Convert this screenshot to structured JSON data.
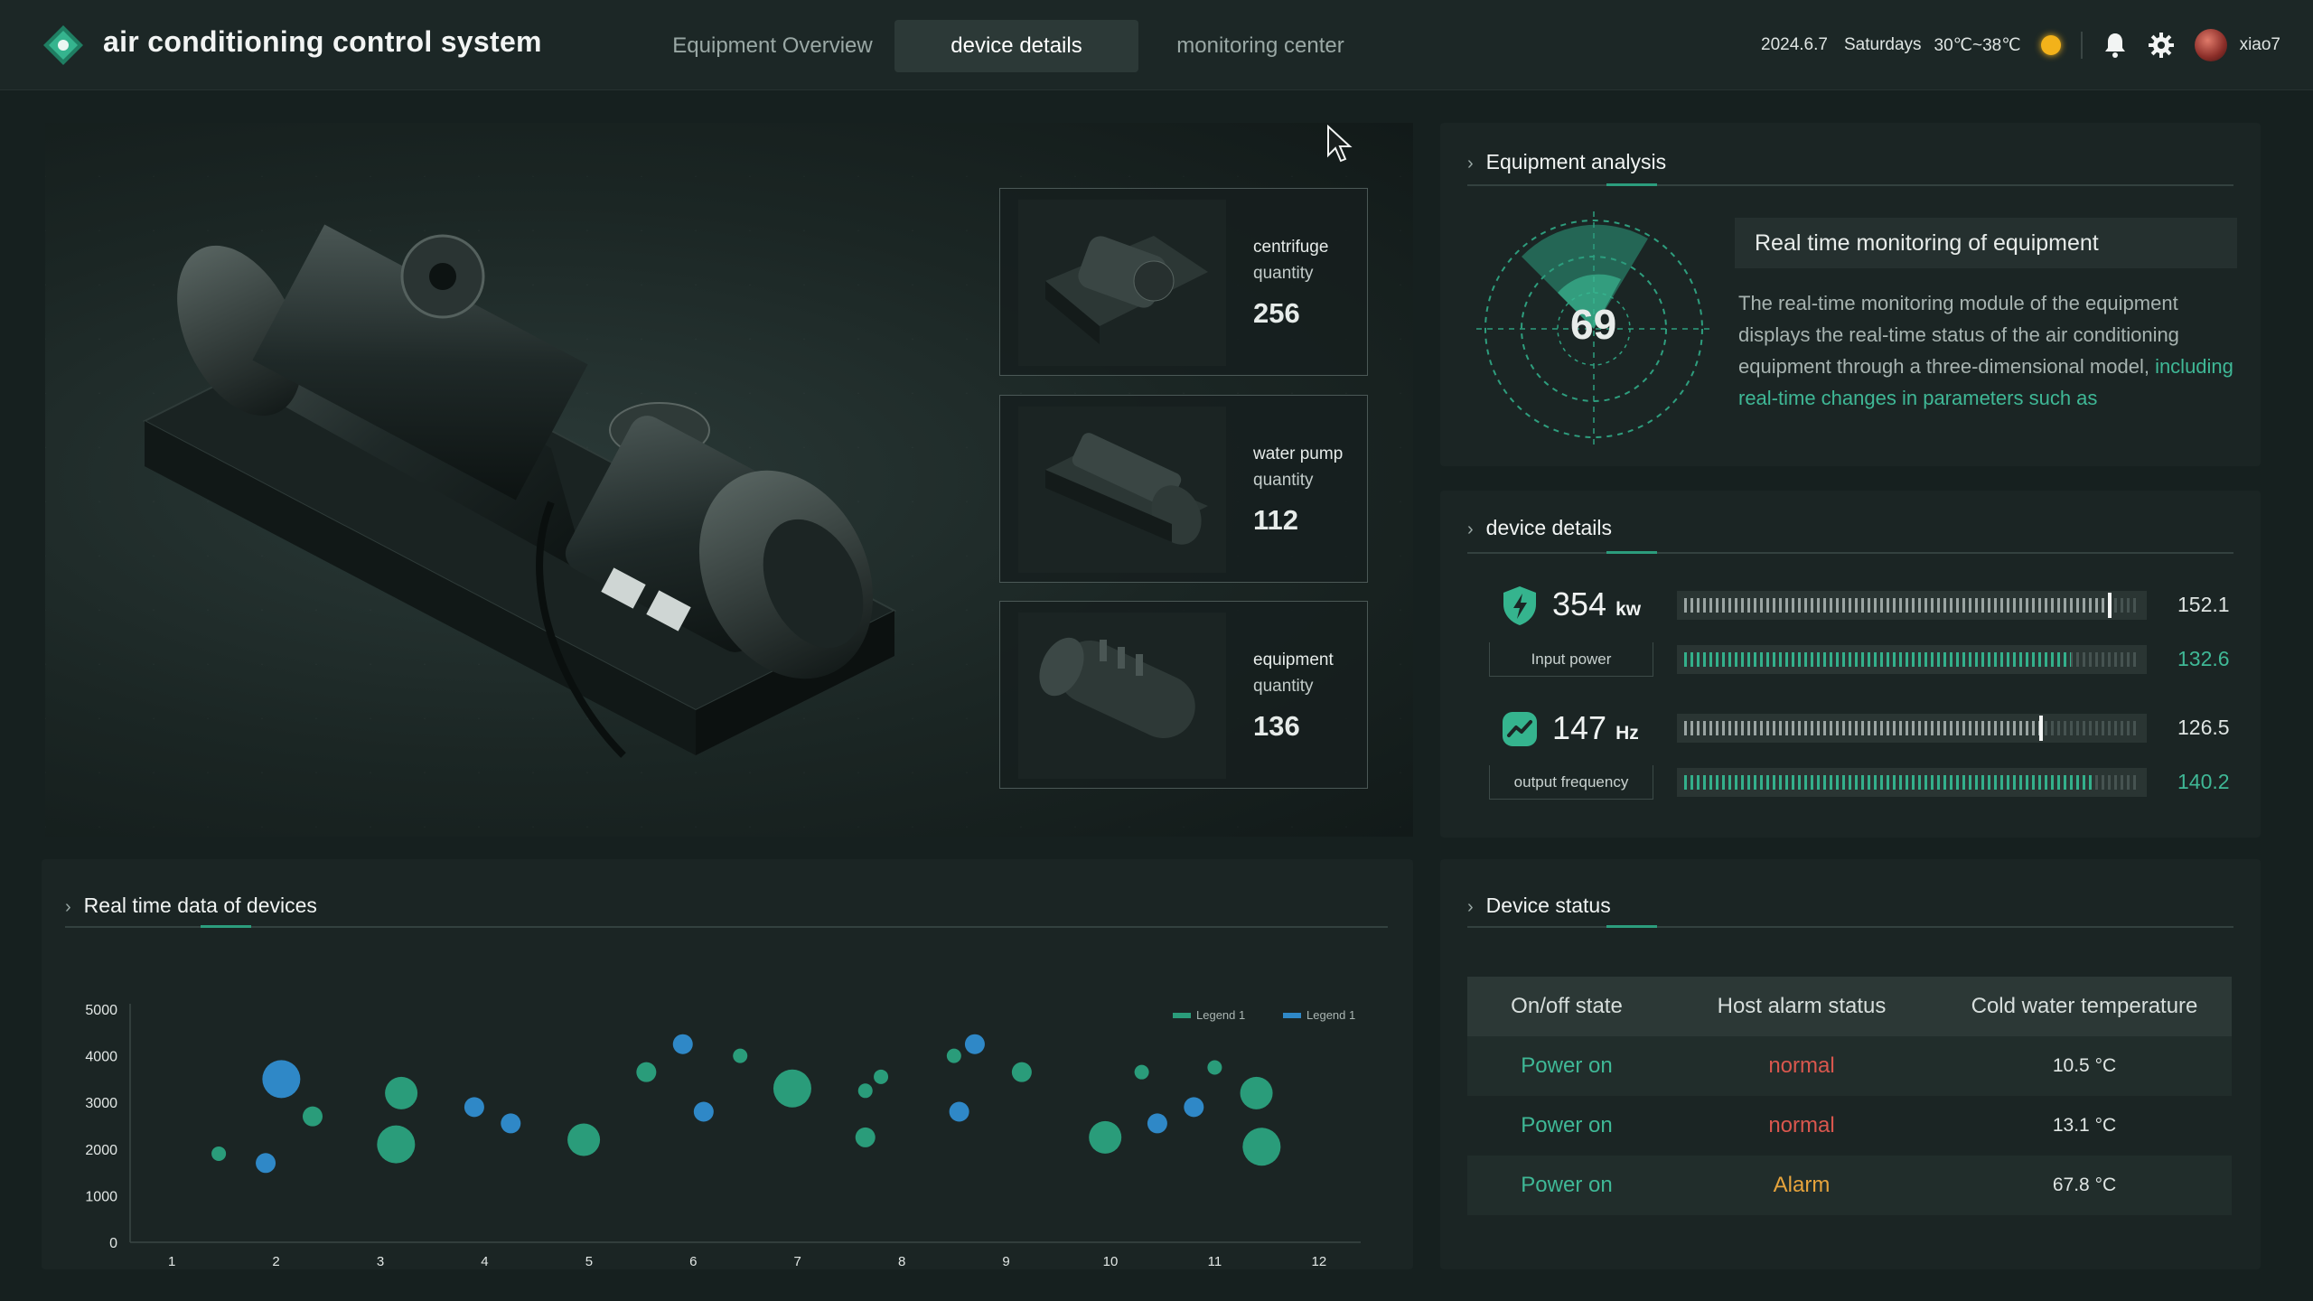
{
  "header": {
    "app_title": "air conditioning control system",
    "logo_icon": "diamond-logo-icon",
    "tabs": [
      {
        "label": "Equipment Overview",
        "active": false
      },
      {
        "label": "device details",
        "active": true
      },
      {
        "label": "monitoring center",
        "active": false
      }
    ],
    "date": "2024.6.7",
    "weekday": "Saturdays",
    "temperature": "30℃~38℃",
    "weather_icon": "sun-icon",
    "username": "xiao7"
  },
  "equipment_cards": [
    {
      "label_line1": "centrifuge",
      "label_line2": "quantity",
      "count": "256"
    },
    {
      "label_line1": "water pump",
      "label_line2": "quantity",
      "count": "112"
    },
    {
      "label_line1": "equipment",
      "label_line2": "quantity",
      "count": "136"
    }
  ],
  "analysis": {
    "title": "Equipment analysis",
    "gauge_value": "69",
    "box_title": "Real time monitoring of equipment",
    "text_normal": "The real-time monitoring module of the equipment displays the real-time status of the air conditioning equipment through a three-dimensional model, ",
    "text_highlight": "including real-time changes in parameters such as"
  },
  "device_details": {
    "title": "device details",
    "metrics": [
      {
        "value": "354",
        "unit": "kw",
        "label": "Input power",
        "icon": "shield-bolt-icon"
      },
      {
        "value": "147",
        "unit": "Hz",
        "label": "output frequency",
        "icon": "trend-line-icon"
      }
    ],
    "bars": [
      {
        "value": "152.1",
        "fraction": 0.93,
        "style": "grey-marker",
        "value_color": "#dfe5e3"
      },
      {
        "value": "132.6",
        "fraction": 0.85,
        "style": "green",
        "value_color": "#3fb896"
      },
      {
        "value": "126.5",
        "fraction": 0.78,
        "style": "grey-marker",
        "value_color": "#dfe5e3"
      },
      {
        "value": "140.2",
        "fraction": 0.9,
        "style": "green",
        "value_color": "#3fb896"
      }
    ]
  },
  "realtime": {
    "title": "Real time data of devices"
  },
  "chart_data": {
    "type": "scatter",
    "title": "",
    "xlabel": "",
    "ylabel": "",
    "xlim": [
      0.6,
      12.4
    ],
    "ylim": [
      0,
      5000
    ],
    "x_ticks": [
      "1",
      "2",
      "3",
      "4",
      "5",
      "6",
      "7",
      "8",
      "9",
      "10",
      "11",
      "12"
    ],
    "y_ticks": [
      "0",
      "1000",
      "2000",
      "3000",
      "4000",
      "5000"
    ],
    "legend_position": "top-right",
    "series": [
      {
        "name": "Legend 1",
        "color": "#2a9c7a",
        "points": [
          [
            1.45,
            1900,
            1
          ],
          [
            2.35,
            2700,
            2
          ],
          [
            3.2,
            3200,
            3
          ],
          [
            3.15,
            2100,
            4
          ],
          [
            4.95,
            2200,
            3
          ],
          [
            5.55,
            3650,
            2
          ],
          [
            6.45,
            4000,
            1
          ],
          [
            6.95,
            3300,
            4
          ],
          [
            7.65,
            3250,
            1
          ],
          [
            7.8,
            3550,
            1
          ],
          [
            7.65,
            2250,
            2
          ],
          [
            8.5,
            4000,
            1
          ],
          [
            9.15,
            3650,
            2
          ],
          [
            9.95,
            2250,
            3
          ],
          [
            10.3,
            3650,
            1
          ],
          [
            11.0,
            3750,
            1
          ],
          [
            11.4,
            3200,
            3
          ],
          [
            11.45,
            2050,
            4
          ]
        ]
      },
      {
        "name": "Legend 1",
        "color": "#2f88c7",
        "points": [
          [
            2.05,
            3500,
            4
          ],
          [
            1.9,
            1700,
            2
          ],
          [
            3.9,
            2900,
            2
          ],
          [
            4.25,
            2550,
            2
          ],
          [
            5.9,
            4250,
            2
          ],
          [
            6.1,
            2800,
            2
          ],
          [
            8.55,
            2800,
            2
          ],
          [
            8.7,
            4250,
            2
          ],
          [
            10.45,
            2550,
            2
          ],
          [
            10.8,
            2900,
            2
          ]
        ]
      }
    ]
  },
  "device_status": {
    "title": "Device status",
    "columns": [
      "On/off state",
      "Host alarm status",
      "Cold water temperature"
    ],
    "rows": [
      {
        "state": "Power on",
        "alarm": "normal",
        "temp": "10.5 °C",
        "alarm_color": "#d9574e"
      },
      {
        "state": "Power on",
        "alarm": "normal",
        "temp": "13.1 °C",
        "alarm_color": "#d9574e"
      },
      {
        "state": "Power on",
        "alarm": "Alarm",
        "temp": "67.8 °C",
        "alarm_color": "#e6a33c"
      }
    ],
    "state_color": "#3fb896"
  }
}
